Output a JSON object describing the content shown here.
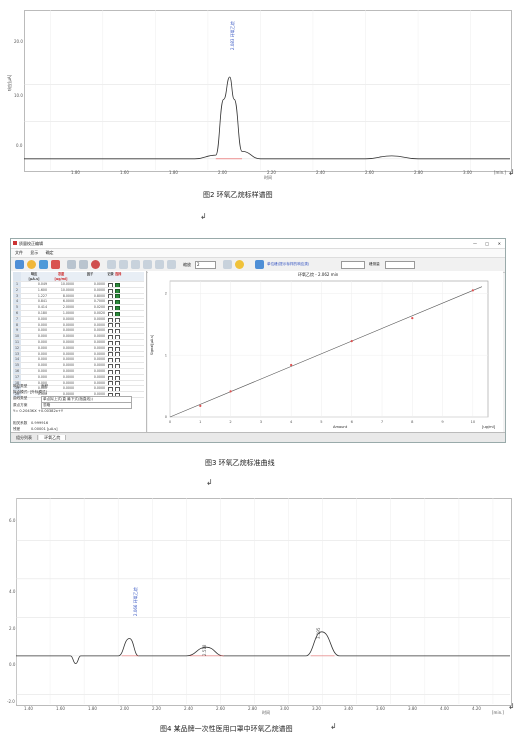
{
  "chart1": {
    "peak_label": "2.083 环氧乙烷",
    "ylabel": "响应[μA]",
    "yticks": [
      "20.0",
      "10.0",
      "0.0"
    ],
    "xticks": [
      "1.80",
      "1.60",
      "1.80",
      "2.00",
      "2.20",
      "2.40",
      "2.60",
      "2.80",
      "3.00"
    ],
    "xlabel": "时间",
    "xunit": "[min.]"
  },
  "caption1": "图2  环氧乙烷标样谱图",
  "window": {
    "title": "质量校正编辑",
    "menu": [
      "文件",
      "显示",
      "确定"
    ],
    "toolbar_zoom_label": "缩放",
    "toolbar_zoom_value": "2",
    "toolbar_mode_label": "单位峰(提示标样的响应类)",
    "toolbar_unit_label": "峰测量",
    "table_headers": [
      "响应\n[μA.s]",
      "浓度\n[ug/ml]",
      "因子",
      "记录",
      "选择"
    ],
    "table_rows": [
      [
        "1",
        "0.049",
        "10.0000",
        "0.0000"
      ],
      [
        "2",
        "1.600",
        "10.0000",
        "0.0000"
      ],
      [
        "3",
        "1.227",
        "8.0000",
        "0.8000"
      ],
      [
        "4",
        "0.841",
        "6.0000",
        "0.7000"
      ],
      [
        "5",
        "0.414",
        "2.0000",
        "0.0200"
      ],
      [
        "6",
        "0.180",
        "1.0000",
        "0.0020"
      ],
      [
        "7",
        "0.000",
        "0.0000",
        "0.0000"
      ],
      [
        "8",
        "0.000",
        "0.0000",
        "0.0000"
      ],
      [
        "9",
        "0.000",
        "0.0000",
        "0.0000"
      ],
      [
        "10",
        "0.000",
        "0.0000",
        "0.0000"
      ],
      [
        "11",
        "0.000",
        "0.0000",
        "0.0000"
      ],
      [
        "12",
        "0.000",
        "0.0000",
        "0.0000"
      ],
      [
        "13",
        "0.000",
        "0.0000",
        "0.0000"
      ],
      [
        "14",
        "0.000",
        "0.0000",
        "0.0000"
      ],
      [
        "15",
        "0.000",
        "0.0000",
        "0.0000"
      ],
      [
        "16",
        "0.000",
        "0.0000",
        "0.0000"
      ],
      [
        "17",
        "0.000",
        "0.0000",
        "0.0000"
      ],
      [
        "18",
        "0.000",
        "0.0000",
        "0.0000"
      ],
      [
        "19",
        "0.000",
        "0.0000",
        "0.0000"
      ],
      [
        "20",
        "0.000",
        "0.0000",
        "0.0000"
      ]
    ],
    "props": {
      "calib_type_label": "响应类型",
      "calib_type_value": "面积",
      "fit_mode": "拟合模式: [外标模式]",
      "curve_type_label": "曲线类型",
      "curve_type_value": "单点拟上式(直 最下式(指直线))",
      "origin_label": "原点方案",
      "origin_value": "忽略",
      "equation": "Y= 0.2043KX  +0.00382x+Y",
      "corr_label": "相关系数",
      "corr_value": "0.999916",
      "resid_label": "残差",
      "resid_value": "0.00001 [μA.s]"
    },
    "tabs": [
      "组分列表",
      "环氧乙烷"
    ],
    "plot": {
      "title": "环氧乙烷 - 2.062 min",
      "ylabel": "Signal[μA.s]",
      "xlabel": "Amount",
      "xunit": "[ug/ml]",
      "xticks": [
        "0",
        "1",
        "2",
        "3",
        "4",
        "5",
        "6",
        "7",
        "8",
        "9",
        "10"
      ],
      "yticks": [
        "0",
        "1",
        "2"
      ]
    }
  },
  "caption2": "图3  环氧乙烷标准曲线",
  "chart3": {
    "peak1_label": "2.066 环氧乙烷",
    "peak2_label": "2.518",
    "peak3_label": "3.195",
    "yticks": [
      "6.0",
      "4.0",
      "2.0",
      "0.0",
      "-2.0"
    ],
    "xticks": [
      "1.40",
      "1.60",
      "1.80",
      "2.00",
      "2.20",
      "2.40",
      "2.60",
      "2.80",
      "3.00",
      "3.20",
      "3.40",
      "3.60",
      "3.80",
      "4.00",
      "4.20"
    ],
    "xlabel": "时间",
    "xunit": "[min.]"
  },
  "caption3": "图4  某品牌一次性医用口罩中环氧乙烷谱图",
  "chart_data": [
    {
      "type": "line",
      "title": "",
      "xlabel": "时间",
      "ylabel": "响应[μA]",
      "xlim": [
        1.3,
        3.15
      ],
      "ylim": [
        -3.0,
        40.0
      ],
      "series": [
        {
          "name": "",
          "x": [
            1.3,
            1.95,
            2.03,
            2.06,
            2.083,
            2.1,
            2.13,
            2.2,
            2.6,
            2.7,
            2.8,
            3.15
          ],
          "y": [
            0.0,
            0.0,
            1.0,
            16.0,
            22.0,
            16.0,
            2.0,
            0.0,
            0.0,
            0.8,
            0.0,
            0.0
          ]
        }
      ]
    },
    {
      "type": "scatter",
      "title": "环氧乙烷 - 2.062 min",
      "xlabel": "Amount",
      "ylabel": "Signal[μA.s]",
      "xlim": [
        0,
        10.5
      ],
      "ylim": [
        0,
        2.2
      ],
      "series": [
        {
          "name": "",
          "x": [
            1,
            2,
            4,
            6,
            8,
            10
          ],
          "y": [
            0.18,
            0.414,
            0.841,
            1.227,
            1.6,
            2.049
          ]
        }
      ]
    },
    {
      "type": "line",
      "title": "",
      "xlabel": "时间",
      "ylabel": "",
      "xlim": [
        1.4,
        4.3
      ],
      "ylim": [
        -2.5,
        8.2
      ],
      "series": [
        {
          "name": "",
          "x": [
            1.4,
            1.72,
            1.75,
            1.78,
            2.0,
            2.066,
            2.12,
            2.4,
            2.518,
            2.62,
            3.1,
            3.195,
            3.3,
            4.3
          ],
          "y": [
            0.0,
            0.0,
            -0.4,
            0.0,
            0.0,
            0.9,
            0.0,
            0.0,
            0.45,
            0.0,
            0.0,
            1.25,
            0.0,
            0.0
          ]
        }
      ]
    }
  ]
}
